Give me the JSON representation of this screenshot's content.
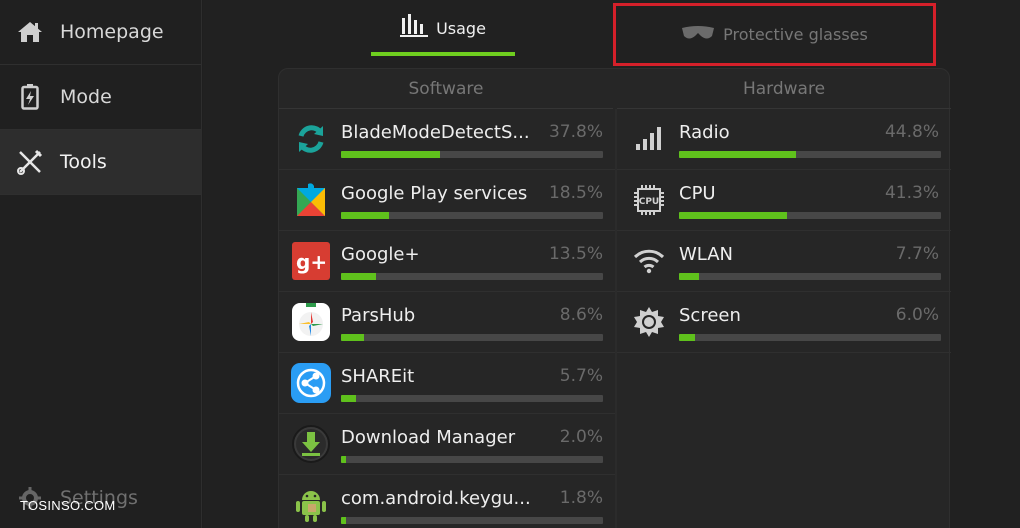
{
  "sidebar": {
    "items": [
      {
        "label": "Homepage",
        "icon": "home-icon",
        "active": false
      },
      {
        "label": "Mode",
        "icon": "battery-icon",
        "active": false
      },
      {
        "label": "Tools",
        "icon": "tools-icon",
        "active": true
      }
    ],
    "settings_label": "Settings"
  },
  "watermark": "TOSINSO.COM",
  "tabs": [
    {
      "label": "Usage",
      "icon": "bar-chart-icon",
      "active": true
    },
    {
      "label": "Protective glasses",
      "icon": "glasses-icon",
      "active": false
    }
  ],
  "software": {
    "header": "Software",
    "rows": [
      {
        "name": "BladeModeDetectS...",
        "percent": "37.8%",
        "fraction": 0.378,
        "icon": "sync-arrows-icon"
      },
      {
        "name": "Google Play services",
        "percent": "18.5%",
        "fraction": 0.185,
        "icon": "puzzle-icon"
      },
      {
        "name": "Google+",
        "percent": "13.5%",
        "fraction": 0.135,
        "icon": "google-plus-icon"
      },
      {
        "name": "ParsHub",
        "percent": "8.6%",
        "fraction": 0.086,
        "icon": "parshub-icon"
      },
      {
        "name": "SHAREit",
        "percent": "5.7%",
        "fraction": 0.057,
        "icon": "shareit-icon"
      },
      {
        "name": "Download Manager",
        "percent": "2.0%",
        "fraction": 0.02,
        "icon": "download-icon"
      },
      {
        "name": "com.android.keygu...",
        "percent": "1.8%",
        "fraction": 0.018,
        "icon": "android-icon"
      }
    ]
  },
  "hardware": {
    "header": "Hardware",
    "rows": [
      {
        "name": "Radio",
        "percent": "44.8%",
        "fraction": 0.448,
        "icon": "signal-icon"
      },
      {
        "name": "CPU",
        "percent": "41.3%",
        "fraction": 0.413,
        "icon": "cpu-icon",
        "icon_text": "CPU"
      },
      {
        "name": "WLAN",
        "percent": "7.7%",
        "fraction": 0.077,
        "icon": "wifi-icon"
      },
      {
        "name": "Screen",
        "percent": "6.0%",
        "fraction": 0.06,
        "icon": "brightness-icon"
      }
    ]
  },
  "colors": {
    "accent": "#6fcf1f",
    "bar_fill": "#5fc11c",
    "highlight_box": "#d5202a"
  }
}
